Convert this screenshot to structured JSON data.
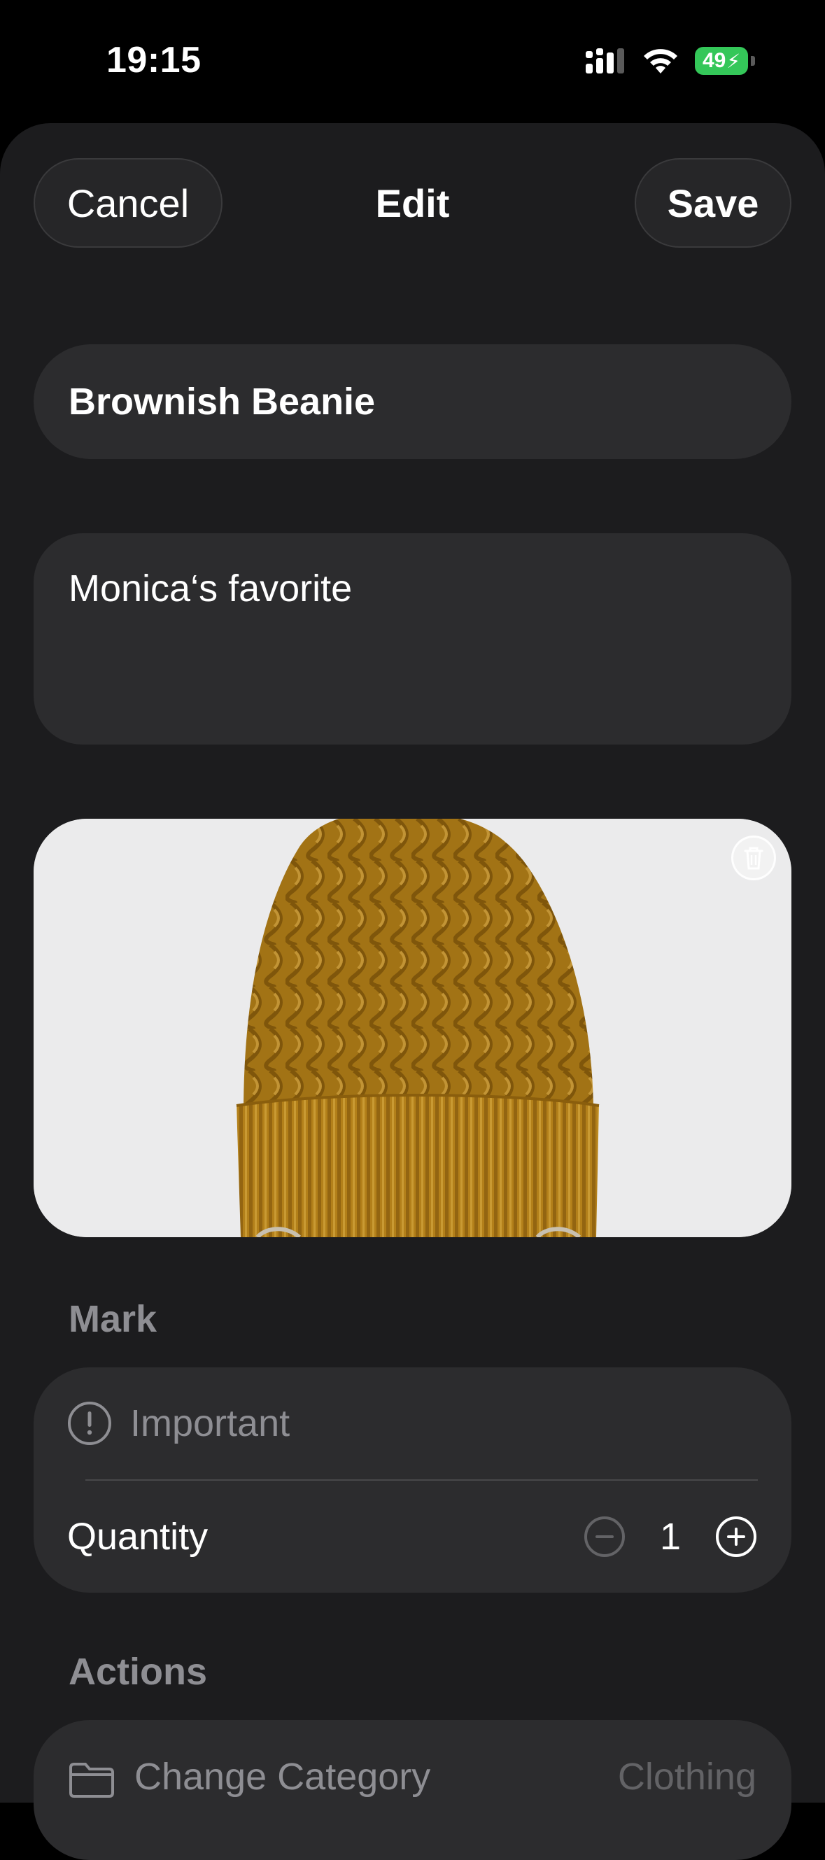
{
  "status_bar": {
    "time": "19:15",
    "battery_level": "49",
    "icons": [
      "cellular-signal-icon",
      "wifi-icon",
      "battery-charging-icon"
    ]
  },
  "nav": {
    "cancel_label": "Cancel",
    "title": "Edit",
    "save_label": "Save"
  },
  "item": {
    "name": "Brownish Beanie",
    "notes": "Monica‘s favorite",
    "photo_subject": "mustard cable-knit beanie"
  },
  "mark_section": {
    "label": "Mark",
    "important_label": "Important",
    "quantity_label": "Quantity",
    "quantity_value": "1"
  },
  "actions_section": {
    "label": "Actions",
    "change_category_label": "Change Category",
    "category_value": "Clothing"
  },
  "colors": {
    "background": "#000000",
    "sheet": "#1c1c1e",
    "card": "#2c2c2e",
    "secondary_text": "#8e8e93",
    "battery": "#34c759",
    "beanie": "#b5851c"
  }
}
